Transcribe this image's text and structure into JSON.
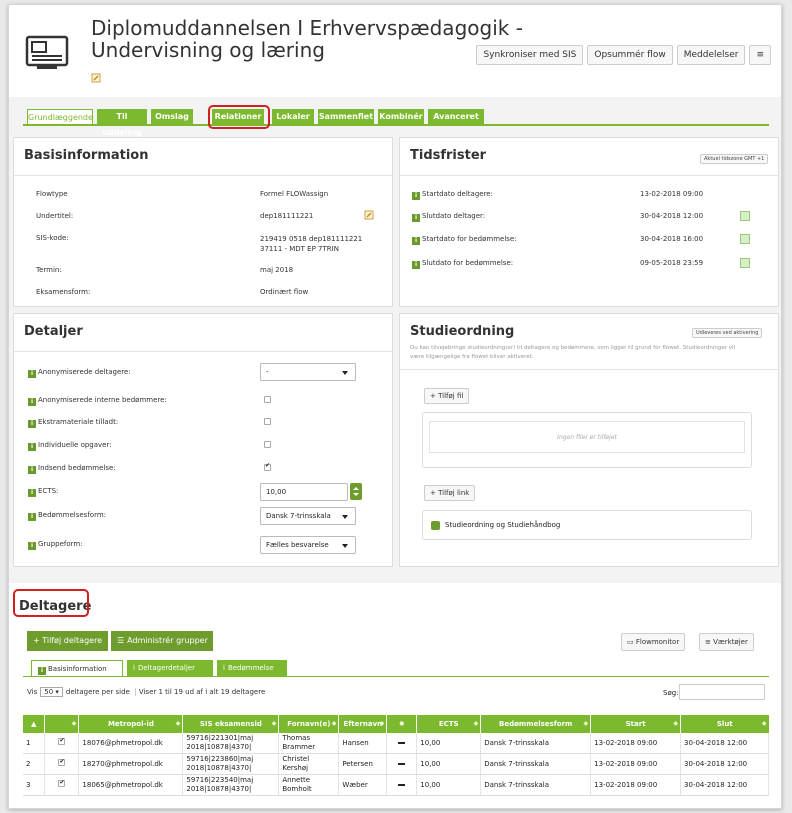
{
  "header": {
    "title_line1": "Diplomuddannelsen I Erhvervspædagogik -",
    "title_line2": "Undervisning og læring",
    "buttons": [
      "Synkroniser med SIS",
      "Opsummér flow",
      "Meddelelser",
      "≡"
    ]
  },
  "tabs": [
    "Grundlæggende",
    "Til uddeling",
    "Omslag",
    "Relationer",
    "Lokaler",
    "Sammenflet",
    "Kombinér",
    "Avanceret"
  ],
  "basis": {
    "title": "Basisinformation",
    "rows": [
      {
        "label": "Flowtype",
        "value": "Formel FLOWassign"
      },
      {
        "label": "Undertitel:",
        "value": "dep181111221"
      },
      {
        "label": "SIS-kode:",
        "value": "219419 0518 dep181111221 37111 - MDT EP 7TRIN"
      },
      {
        "label": "Termin:",
        "value": "maj 2018"
      },
      {
        "label": "Eksamensform:",
        "value": "Ordinært flow"
      }
    ]
  },
  "tidsfrister": {
    "title": "Tidsfrister",
    "tz_badge": "Aktuel tidszone GMT +1",
    "rows": [
      {
        "label": "Startdato deltagere:",
        "value": "13-02-2018 09:00"
      },
      {
        "label": "Slutdato deltager:",
        "value": "30-04-2018 12:00"
      },
      {
        "label": "Startdato for bedømmelse:",
        "value": "30-04-2018 16:00"
      },
      {
        "label": "Slutdato for bedømmelse:",
        "value": "09-05-2018 23:59"
      }
    ]
  },
  "detaljer": {
    "title": "Detaljer",
    "anon_label": "Anonymiserede deltagere:",
    "anon_value": "-",
    "anon_intern_label": "Anonymiserede interne bedømmere:",
    "ekstra_label": "Ekstramateriale tilladt:",
    "indiv_label": "Individuelle opgaver:",
    "indsend_label": "Indsend bedømmelse:",
    "ects_label": "ECTS:",
    "ects_value": "10,00",
    "bedform_label": "Bedømmelsesform:",
    "bedform_value": "Dansk 7-trinsskala",
    "gruppe_label": "Gruppeform:",
    "gruppe_value": "Fælles besvarelse"
  },
  "studieordning": {
    "title": "Studieordning",
    "badge": "Udleveres ved aktivering",
    "desc": "Du kan tilvejebringe studieordning(er) til deltagere og bedømmere, som ligger til grund for flowet. Studieordninger vil være tilgængelige fra flowet bliver aktiveret.",
    "add_file": "+ Tilføj fil",
    "no_files": "Ingen filer er tilføjet",
    "add_link": "+ Tilføj link",
    "link_label": "Studieordning og Studiehåndbog"
  },
  "deltagere": {
    "title": "Deltagere",
    "add_btn": "+ Tilføj deltagere",
    "groups_btn": "Administrér grupper",
    "flowmonitor": "Flowmonitor",
    "tools": "Værktøjer",
    "subtabs": [
      "Basisinformation",
      "Deltagerdetaljer",
      "Bedømmelse"
    ],
    "vis": "Vis",
    "per_page": "50",
    "per_page_label": "deltagere per side",
    "showing": "Viser 1 til 19 ud af i alt 19 deltagere",
    "search_label": "Søg:",
    "columns": [
      "",
      "",
      "Metropol-id",
      "SIS eksamensid",
      "Fornavn(e)",
      "Efternavn",
      "",
      "ECTS",
      "Bedømmelsesform",
      "Start",
      "Slut"
    ],
    "rows": [
      {
        "n": "1",
        "id": "18076@phmetropol.dk",
        "sis": "59716|221301|maj 2018|10878|4370|",
        "first": "Thomas Brammer",
        "last": "Hansen",
        "ects": "10,00",
        "form": "Dansk 7-trinsskala",
        "start": "13-02-2018 09:00",
        "slut": "30-04-2018 12:00"
      },
      {
        "n": "2",
        "id": "18270@phmetropol.dk",
        "sis": "59716|223860|maj 2018|10878|4370|",
        "first": "Christel Kershøj",
        "last": "Petersen",
        "ects": "10,00",
        "form": "Dansk 7-trinsskala",
        "start": "13-02-2018 09:00",
        "slut": "30-04-2018 12:00"
      },
      {
        "n": "3",
        "id": "18065@phmetropol.dk",
        "sis": "59716|223540|maj 2018|10878|4370|",
        "first": "Annette Bomholt",
        "last": "Wæber",
        "ects": "10,00",
        "form": "Dansk 7-trinsskala",
        "start": "13-02-2018 09:00",
        "slut": "30-04-2018 12:00"
      }
    ]
  },
  "colors": {
    "accent": "#7cb92e",
    "highlight": "#d0201f"
  }
}
